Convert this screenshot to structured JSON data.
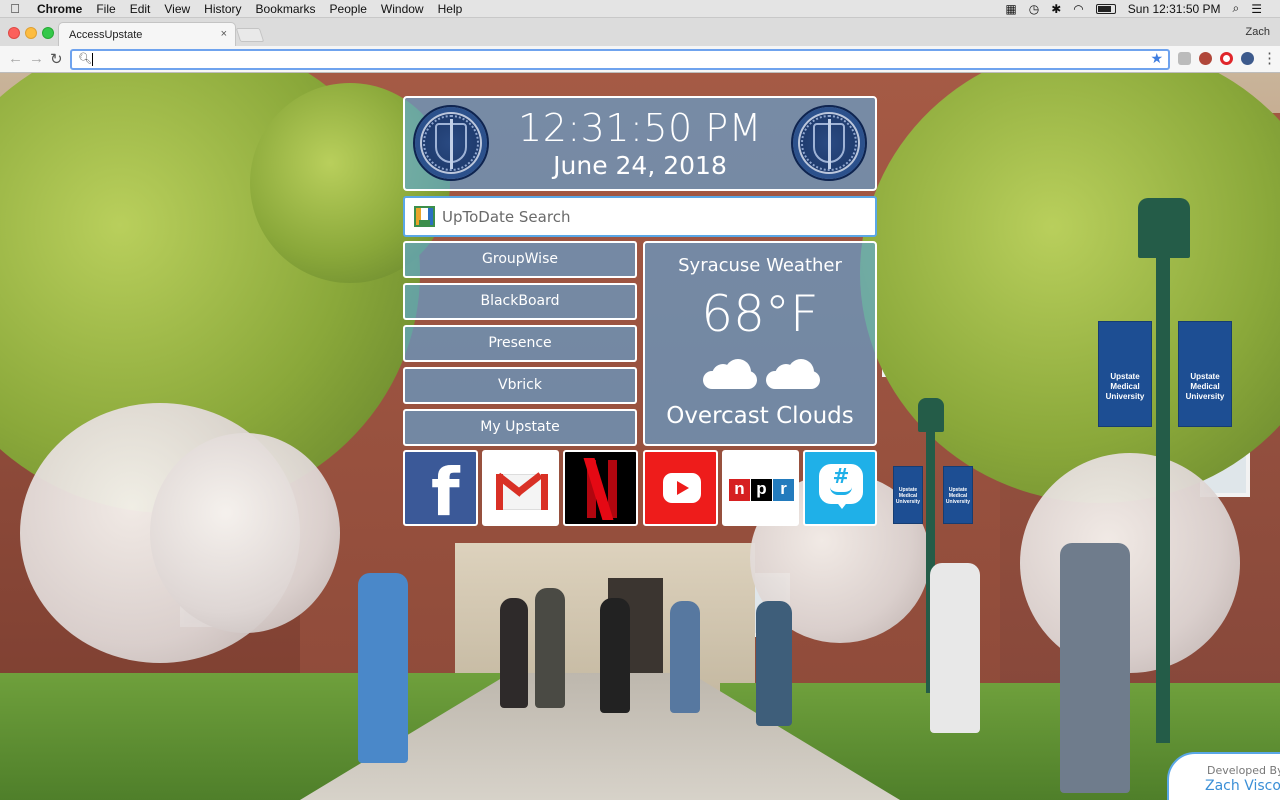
{
  "menubar": {
    "apple": "",
    "items": [
      "Chrome",
      "File",
      "Edit",
      "View",
      "History",
      "Bookmarks",
      "People",
      "Window",
      "Help"
    ],
    "clock": "Sun 12:31:50 PM"
  },
  "browser": {
    "tab_title": "AccessUpstate",
    "tab_close": "×",
    "profile": "Zach",
    "url": ""
  },
  "clock": {
    "time": "12:31:50 PM",
    "date": "June 24, 2018"
  },
  "search": {
    "placeholder": "UpToDate Search"
  },
  "links": [
    "GroupWise",
    "BlackBoard",
    "Presence",
    "Vbrick",
    "My Upstate"
  ],
  "weather": {
    "title": "Syracuse Weather",
    "temp": "68°F",
    "condition": "Overcast Clouds",
    "icon": "overcast-clouds-icon"
  },
  "tiles": [
    {
      "name": "facebook",
      "icon": "facebook-icon",
      "color": "#3b5998"
    },
    {
      "name": "gmail",
      "icon": "gmail-icon",
      "color": "#d93025"
    },
    {
      "name": "netflix",
      "icon": "netflix-icon",
      "color": "#e50914"
    },
    {
      "name": "youtube",
      "icon": "youtube-icon",
      "color": "#ee1c1b"
    },
    {
      "name": "npr",
      "icon": "npr-icon",
      "letters": [
        "n",
        "p",
        "r"
      ]
    },
    {
      "name": "groupme",
      "icon": "groupme-icon",
      "color": "#1fb0e8"
    }
  ],
  "scene": {
    "banner_text": "Upstate Medical University"
  },
  "developer": {
    "label": "Developed By:",
    "name": "Zach Visco"
  },
  "colors": {
    "panel": "#5caae1",
    "accent": "#3b8fd6"
  }
}
